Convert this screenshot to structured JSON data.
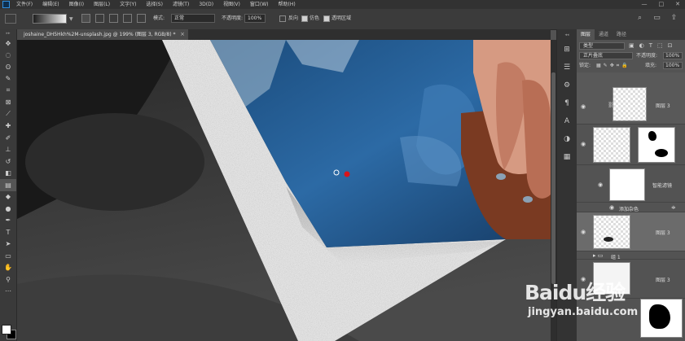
{
  "menubar": {
    "items": [
      "文件(F)",
      "编辑(E)",
      "图像(I)",
      "图层(L)",
      "文字(Y)",
      "选择(S)",
      "滤镜(T)",
      "3D(D)",
      "视图(V)",
      "窗口(W)",
      "帮助(H)"
    ],
    "window_controls": [
      "—",
      "□",
      "✕"
    ]
  },
  "options": {
    "mode_label": "模式:",
    "mode_value": "正常",
    "opacity_label": "不透明度:",
    "opacity_value": "100%",
    "reverse_label": "反向",
    "dither_label": "仿色",
    "transparency_label": "透明区域"
  },
  "document": {
    "tab_title": "joshaine_DH5Hkh%2M-unsplash.jpg @ 199% (图层 3, RGB/8) *",
    "close": "×"
  },
  "layers_panel": {
    "tabs": [
      "图层",
      "通道",
      "路径"
    ],
    "filter_kind": "类型",
    "blend_mode": "正片叠底",
    "opacity_label": "不透明度:",
    "opacity_value": "100%",
    "lock_label": "锁定:",
    "fill_label": "填充:",
    "fill_value": "100%",
    "layers": [
      {
        "name": "图层 3"
      },
      {
        "name": ""
      },
      {
        "name": "智能滤镜"
      },
      {
        "name": "添加杂色"
      },
      {
        "name": "图层 3"
      },
      {
        "name": "组 1"
      },
      {
        "name": "图层 3"
      }
    ]
  },
  "colors": {
    "fg": "#ffffff",
    "bg": "#000000",
    "accent": "#31a8ff"
  },
  "watermark": {
    "logo_text": "Baidu经验",
    "url": "jingyan.baidu.com"
  }
}
